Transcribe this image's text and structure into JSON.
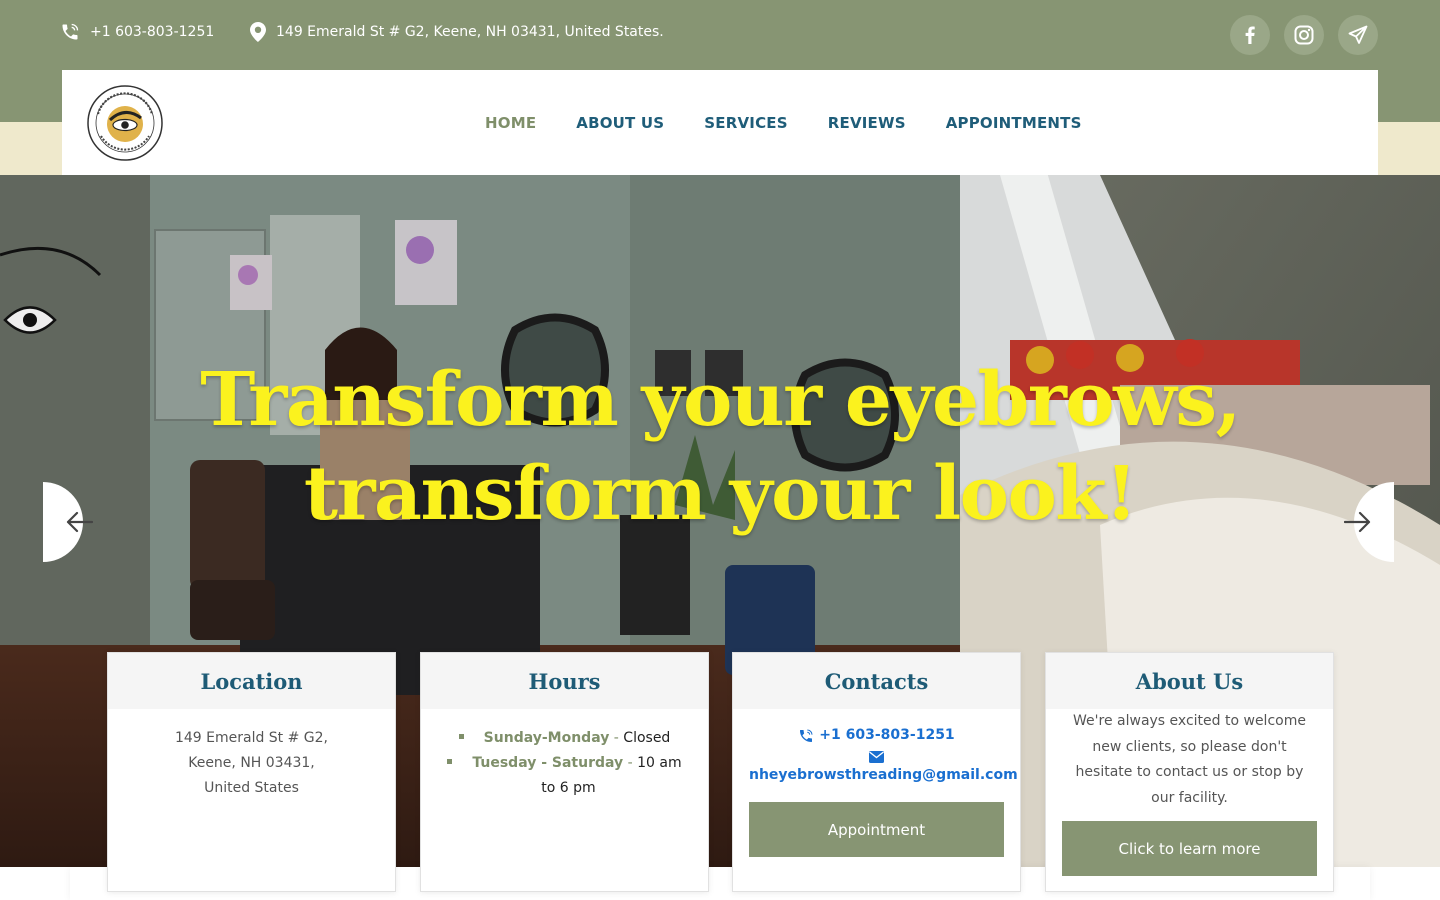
{
  "topbar": {
    "phone": "+1 603-803-1251",
    "address": "149 Emerald St # G2, Keene, NH 03431, United States.",
    "socials": [
      "facebook-icon",
      "instagram-icon",
      "telegram-icon"
    ]
  },
  "nav": {
    "items": [
      {
        "label": "HOME",
        "active": true
      },
      {
        "label": "ABOUT US",
        "active": false
      },
      {
        "label": "SERVICES",
        "active": false
      },
      {
        "label": "REVIEWS",
        "active": false
      },
      {
        "label": "APPOINTMENTS",
        "active": false
      }
    ]
  },
  "hero": {
    "line1": "Transform your eyebrows,",
    "line2": "transform your look!"
  },
  "cards": {
    "location": {
      "title": "Location",
      "line1": "149 Emerald St # G2,",
      "line2": "Keene, NH 03431,",
      "line3": "United States"
    },
    "hours": {
      "title": "Hours",
      "row1_day": "Sunday-Monday",
      "row1_sep": " - ",
      "row1_value": "Closed",
      "row2_day": "Tuesday - Saturday",
      "row2_sep": " - ",
      "row2_value": "10 am",
      "row2_value2": "to 6 pm"
    },
    "contacts": {
      "title": "Contacts",
      "phone": "+1 603-803-1251",
      "email": "nheyebrowsthreading@gmail.com",
      "button": "Appointment"
    },
    "about": {
      "title": "About Us",
      "text": "We're always excited to welcome new clients, so please don't hesitate to contact us or stop by our facility.",
      "button": "Click to learn more"
    }
  },
  "colors": {
    "accent_green": "#879573",
    "nav_blue": "#1f5d79",
    "hero_yellow": "#fbf21e",
    "link_blue": "#1a6fd0",
    "cream": "#efe9cc"
  }
}
